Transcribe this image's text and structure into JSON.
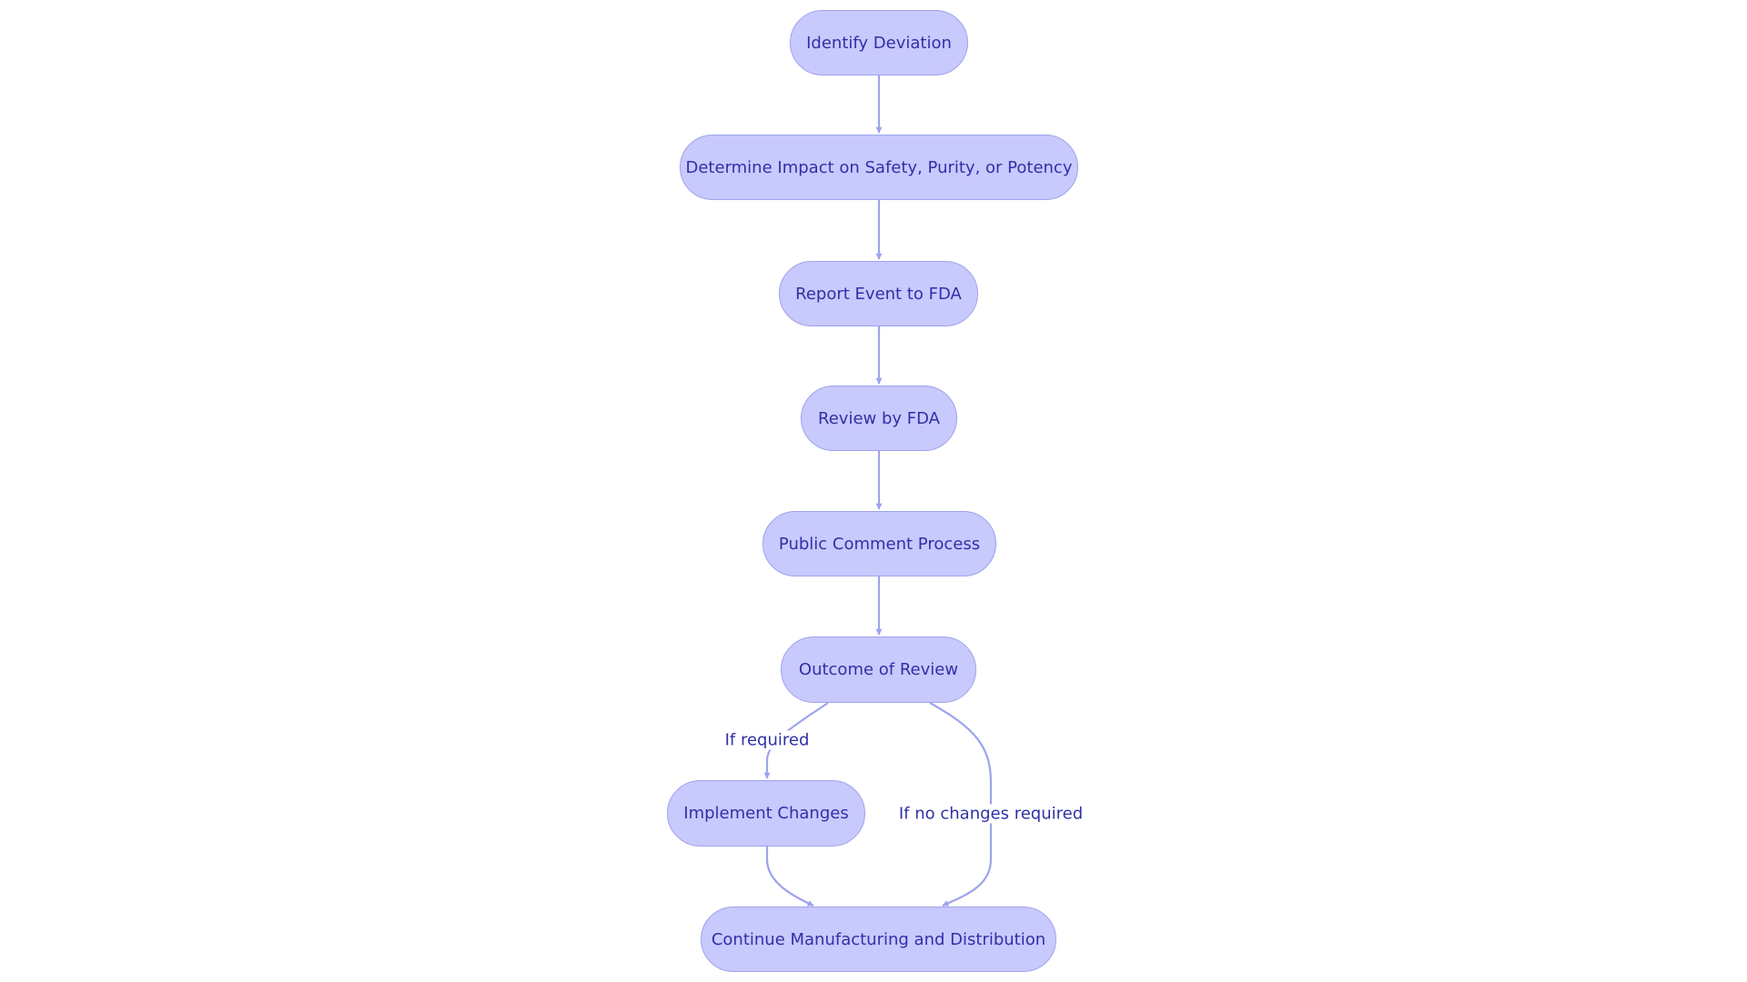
{
  "colors": {
    "node_fill": "#c8c9fd",
    "node_stroke": "#9fa3ea",
    "text": "#2f31a6",
    "edge": "#9ea3ec"
  },
  "nodes": [
    {
      "id": "identify",
      "label": "Identify Deviation"
    },
    {
      "id": "impact",
      "label": "Determine Impact on Safety, Purity, or Potency"
    },
    {
      "id": "report",
      "label": "Report Event to FDA"
    },
    {
      "id": "review",
      "label": "Review by FDA"
    },
    {
      "id": "comment",
      "label": "Public Comment Process"
    },
    {
      "id": "outcome",
      "label": "Outcome of Review"
    },
    {
      "id": "implement",
      "label": "Implement Changes"
    },
    {
      "id": "continue",
      "label": "Continue Manufacturing and Distribution"
    }
  ],
  "edges": [
    {
      "from": "identify",
      "to": "impact",
      "label": ""
    },
    {
      "from": "impact",
      "to": "report",
      "label": ""
    },
    {
      "from": "report",
      "to": "review",
      "label": ""
    },
    {
      "from": "review",
      "to": "comment",
      "label": ""
    },
    {
      "from": "comment",
      "to": "outcome",
      "label": ""
    },
    {
      "from": "outcome",
      "to": "implement",
      "label": "If required"
    },
    {
      "from": "outcome",
      "to": "continue",
      "label": "If no changes required"
    },
    {
      "from": "implement",
      "to": "continue",
      "label": ""
    }
  ]
}
